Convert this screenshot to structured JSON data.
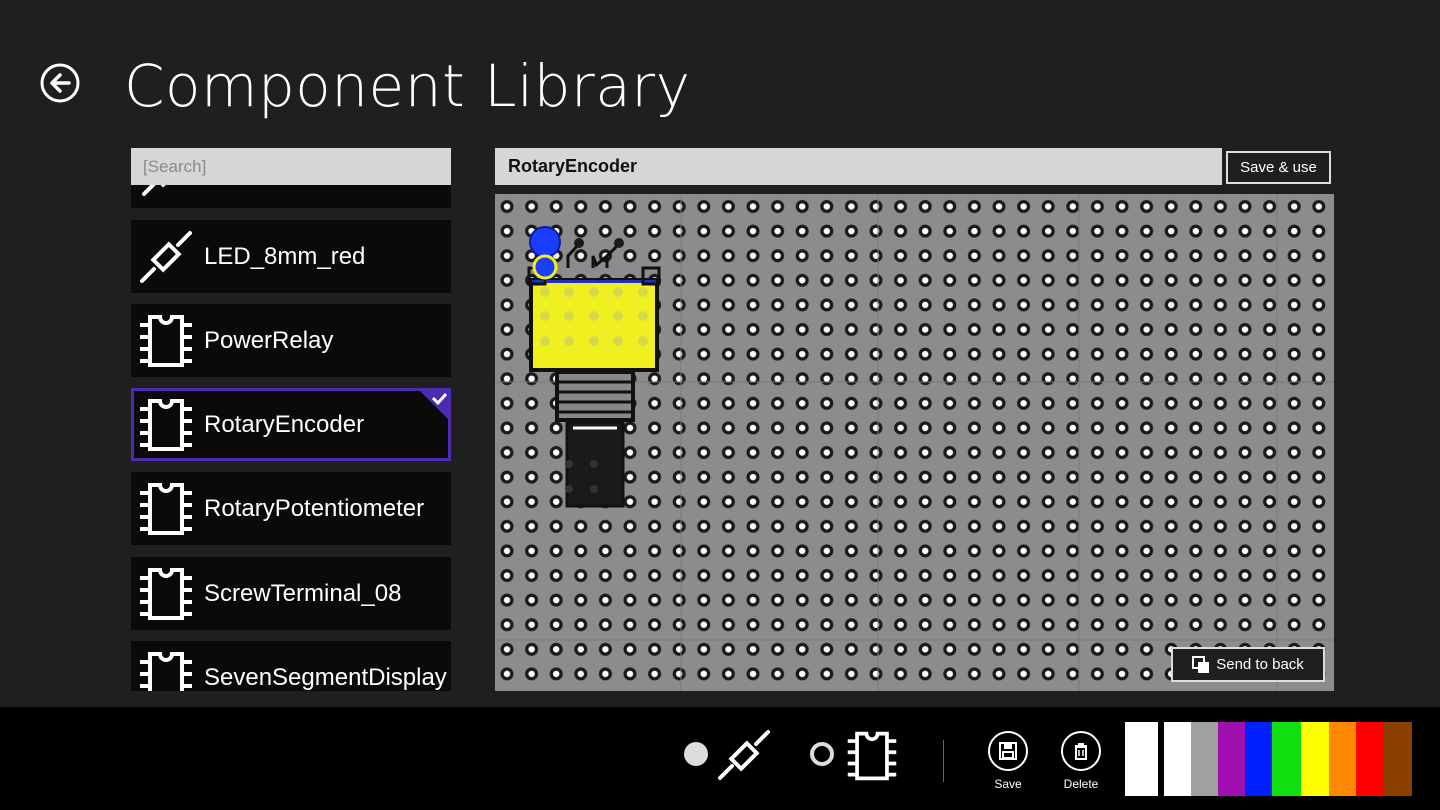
{
  "header": {
    "title": "Component Library",
    "back_icon": "back-arrow-icon"
  },
  "search": {
    "placeholder": "[Search]"
  },
  "library": {
    "items": [
      {
        "label": "LED_8mm_red",
        "icon": "led-icon"
      },
      {
        "label": "PowerRelay",
        "icon": "chip-icon"
      },
      {
        "label": "RotaryEncoder",
        "icon": "chip-icon",
        "selected": true
      },
      {
        "label": "RotaryPotentiometer",
        "icon": "chip-icon"
      },
      {
        "label": "ScrewTerminal_08",
        "icon": "chip-icon"
      },
      {
        "label": "SevenSegmentDisplay",
        "icon": "chip-icon"
      }
    ]
  },
  "editor": {
    "component_name": "RotaryEncoder",
    "save_use_label": "Save & use",
    "send_back_label": "Send to back"
  },
  "appbar": {
    "save_label": "Save",
    "delete_label": "Delete",
    "colors": [
      "#ffffff",
      "#ffffff",
      "#a0a0a0",
      "#a010b0",
      "#0020ff",
      "#10e010",
      "#ffff00",
      "#ff8800",
      "#ff0000",
      "#8b4000",
      "#000000"
    ]
  }
}
